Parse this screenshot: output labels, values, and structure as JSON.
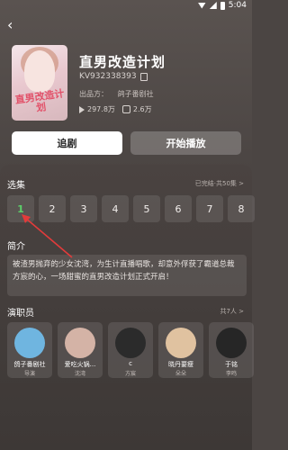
{
  "status_bar": {
    "time": "5:04"
  },
  "header": {
    "title": "直男改造计划",
    "code": "KV932338393",
    "producer_label": "出品方：",
    "producer": "鸽子番剧社",
    "plays": "297.8万",
    "likes": "2.6万",
    "cover_text": "直男改造计划"
  },
  "actions": {
    "follow_label": "追剧",
    "play_label": "开始播放"
  },
  "episodes": {
    "title": "选集",
    "more": "已完结·共50集 >",
    "items": [
      "1",
      "2",
      "3",
      "4",
      "5",
      "6",
      "7",
      "8"
    ],
    "active_index": 0
  },
  "synopsis": {
    "title": "简介",
    "text": "被渣男抛弃的少女沈湾，为生计直播唱歌，却意外俘获了霸道总裁方宸的心，一场甜蜜的直男改造计划正式开启！"
  },
  "cast": {
    "title": "演职员",
    "more": "共7人 >",
    "items": [
      {
        "name": "鸽子番剧社",
        "role": "导演",
        "color": "#6fb5e0"
      },
      {
        "name": "爱吃火锅...",
        "role": "沈湾",
        "color": "#d4b3a6"
      },
      {
        "name": "c",
        "role": "方宸",
        "color": "#2b2b2b"
      },
      {
        "name": "晓丹要瘦",
        "role": "朵朵",
        "color": "#e0c2a0"
      },
      {
        "name": "于铭",
        "role": "李鸣",
        "color": "#262626"
      }
    ]
  }
}
